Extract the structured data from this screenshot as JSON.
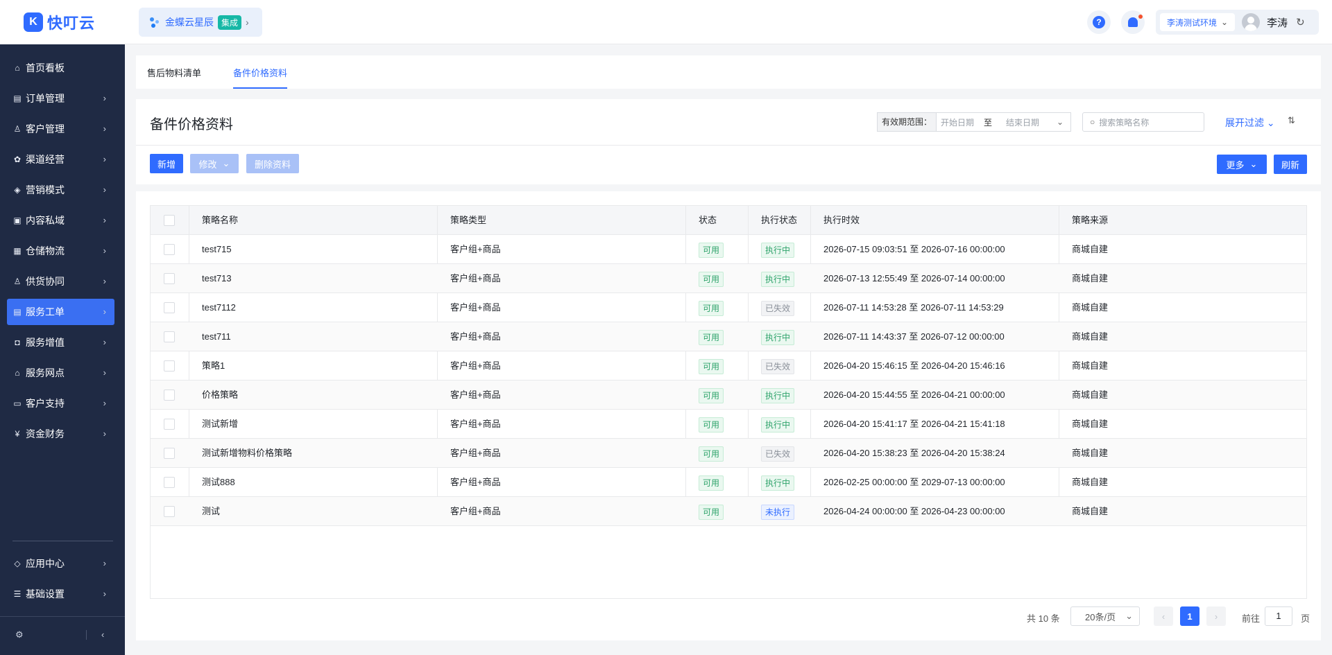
{
  "brand": {
    "logo_glyph": "K",
    "name": "快叮云"
  },
  "app_switcher": {
    "name": "金蝶云星辰",
    "tag": "集成"
  },
  "header": {
    "help_glyph": "?",
    "env": "李涛测试环境",
    "user": "李涛"
  },
  "sidebar": {
    "items": [
      {
        "label": "首页看板",
        "icon": "home-icon",
        "chevron": false,
        "active": false
      },
      {
        "label": "订单管理",
        "icon": "clipboard-icon",
        "chevron": true,
        "active": false
      },
      {
        "label": "客户管理",
        "icon": "user-icon",
        "chevron": true,
        "active": false
      },
      {
        "label": "渠道经营",
        "icon": "channel-icon",
        "chevron": true,
        "active": false
      },
      {
        "label": "营销模式",
        "icon": "tag-icon",
        "chevron": true,
        "active": false
      },
      {
        "label": "内容私域",
        "icon": "image-icon",
        "chevron": true,
        "active": false
      },
      {
        "label": "仓储物流",
        "icon": "warehouse-icon",
        "chevron": true,
        "active": false
      },
      {
        "label": "供货协同",
        "icon": "supplier-icon",
        "chevron": true,
        "active": false
      },
      {
        "label": "服务工单",
        "icon": "ticket-icon",
        "chevron": true,
        "active": true
      },
      {
        "label": "服务增值",
        "icon": "bag-icon",
        "chevron": true,
        "active": false
      },
      {
        "label": "服务网点",
        "icon": "store-icon",
        "chevron": true,
        "active": false
      },
      {
        "label": "客户支持",
        "icon": "support-icon",
        "chevron": true,
        "active": false
      },
      {
        "label": "资金财务",
        "icon": "yuan-icon",
        "chevron": true,
        "active": false
      }
    ],
    "bottom_items": [
      {
        "label": "应用中心",
        "icon": "cube-icon"
      },
      {
        "label": "基础设置",
        "icon": "settings-sliders-icon"
      }
    ]
  },
  "tabs": [
    {
      "label": "售后物料清单",
      "active": false
    },
    {
      "label": "备件价格资料",
      "active": true
    }
  ],
  "page": {
    "title": "备件价格资料",
    "date_range_label": "有效期范围：",
    "date_start_placeholder": "开始日期",
    "date_to": "至",
    "date_end_placeholder": "结束日期",
    "search_placeholder": "搜索策略名称",
    "filter_toggle": "展开过滤"
  },
  "toolbar": {
    "add": "新增",
    "edit": "修改",
    "delete": "删除资料",
    "more": "更多",
    "refresh": "刷新"
  },
  "table": {
    "columns": [
      "策略名称",
      "策略类型",
      "状态",
      "执行状态",
      "执行时效",
      "策略来源"
    ],
    "rows": [
      {
        "name": "test715",
        "type": "客户组+商品",
        "status": "可用",
        "exec": "执行中",
        "exec_kind": "green",
        "period": "2026-07-15 09:03:51 至 2026-07-16 00:00:00",
        "source": "商城自建"
      },
      {
        "name": "test713",
        "type": "客户组+商品",
        "status": "可用",
        "exec": "执行中",
        "exec_kind": "green",
        "period": "2026-07-13 12:55:49 至 2026-07-14 00:00:00",
        "source": "商城自建"
      },
      {
        "name": "test7112",
        "type": "客户组+商品",
        "status": "可用",
        "exec": "已失效",
        "exec_kind": "gray",
        "period": "2026-07-11 14:53:28 至 2026-07-11 14:53:29",
        "source": "商城自建"
      },
      {
        "name": "test711",
        "type": "客户组+商品",
        "status": "可用",
        "exec": "执行中",
        "exec_kind": "green",
        "period": "2026-07-11 14:43:37 至 2026-07-12 00:00:00",
        "source": "商城自建"
      },
      {
        "name": "策略1",
        "type": "客户组+商品",
        "status": "可用",
        "exec": "已失效",
        "exec_kind": "gray",
        "period": "2026-04-20 15:46:15 至 2026-04-20 15:46:16",
        "source": "商城自建"
      },
      {
        "name": "价格策略",
        "type": "客户组+商品",
        "status": "可用",
        "exec": "执行中",
        "exec_kind": "green",
        "period": "2026-04-20 15:44:55 至 2026-04-21 00:00:00",
        "source": "商城自建"
      },
      {
        "name": "测试新增",
        "type": "客户组+商品",
        "status": "可用",
        "exec": "执行中",
        "exec_kind": "green",
        "period": "2026-04-20 15:41:17 至 2026-04-21 15:41:18",
        "source": "商城自建"
      },
      {
        "name": "测试新增物料价格策略",
        "type": "客户组+商品",
        "status": "可用",
        "exec": "已失效",
        "exec_kind": "gray",
        "period": "2026-04-20 15:38:23 至 2026-04-20 15:38:24",
        "source": "商城自建"
      },
      {
        "name": "测试888",
        "type": "客户组+商品",
        "status": "可用",
        "exec": "执行中",
        "exec_kind": "green",
        "period": "2026-02-25 00:00:00 至 2029-07-13 00:00:00",
        "source": "商城自建"
      },
      {
        "name": "测试",
        "type": "客户组+商品",
        "status": "可用",
        "exec": "未执行",
        "exec_kind": "blue",
        "period": "2026-04-24 00:00:00 至 2026-04-23 00:00:00",
        "source": "商城自建"
      }
    ]
  },
  "pagination": {
    "total": "共 10 条",
    "page_size": "20条/页",
    "current": "1",
    "goto_label": "前往",
    "goto_value": "1",
    "page_suffix": "页"
  },
  "colors": {
    "accent": "#2f6bff",
    "sidebar_bg": "#1f2a44",
    "success": "#2fa36b"
  }
}
